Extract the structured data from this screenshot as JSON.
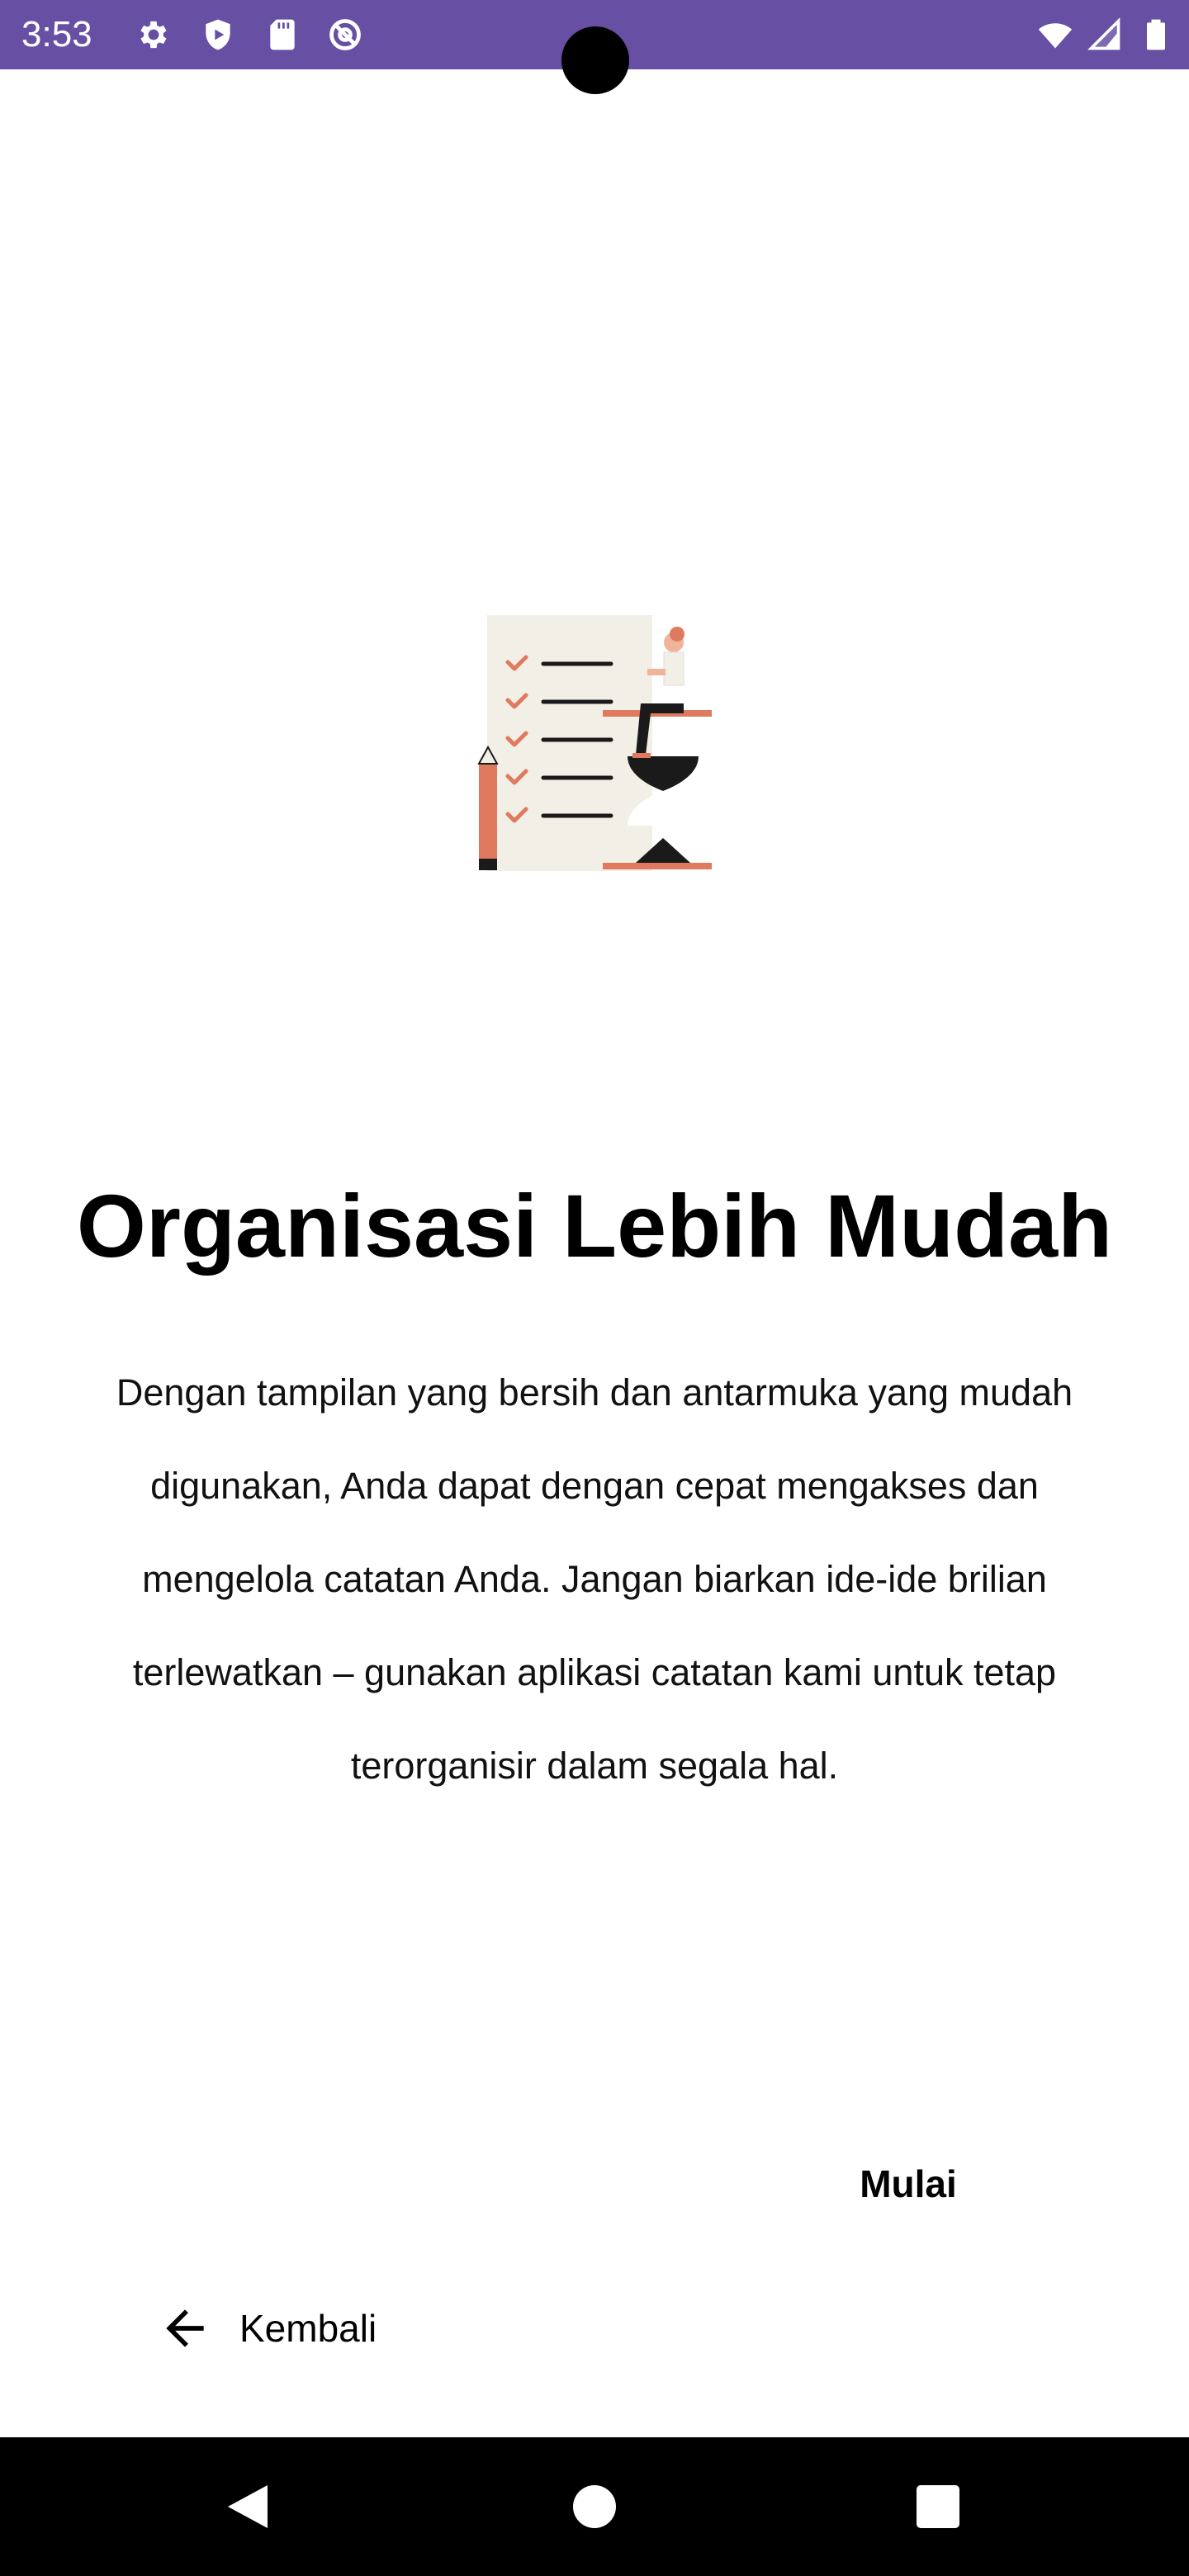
{
  "status_bar": {
    "time": "3:53",
    "background_color": "#6750A4",
    "left_icons": [
      "gear-icon",
      "shield-icon",
      "sd-card-icon",
      "at-sign-icon"
    ],
    "right_icons": [
      "wifi-icon",
      "cellular-signal-icon",
      "battery-icon"
    ]
  },
  "illustration": {
    "icon": "checklist-hourglass-illustration",
    "accent_color": "#E07A5F",
    "paper_color": "#F2EFE6"
  },
  "onboarding": {
    "title": "Organisasi Lebih Mudah",
    "description": "Dengan tampilan yang bersih dan antarmuka yang mudah digunakan, Anda dapat dengan cepat mengakses dan mengelola catatan Anda. Jangan biarkan ide-ide brilian terlewatkan – gunakan aplikasi catatan kami untuk tetap terorganisir dalam segala hal."
  },
  "actions": {
    "start_label": "Mulai",
    "back_label": "Kembali",
    "back_icon": "arrow-left-icon"
  },
  "nav_bar": {
    "buttons": [
      "back-triangle-icon",
      "home-circle-icon",
      "recents-square-icon"
    ]
  }
}
